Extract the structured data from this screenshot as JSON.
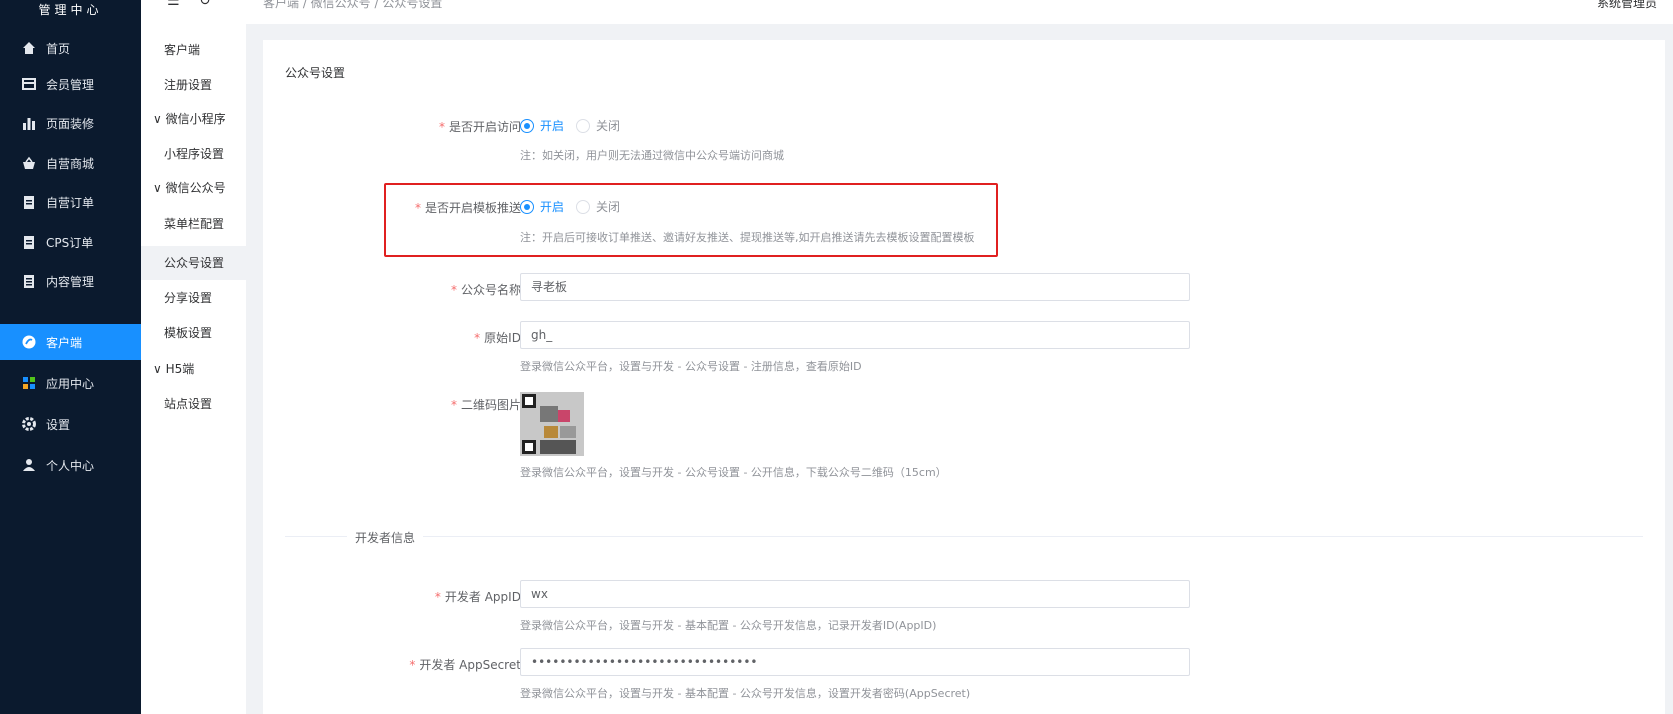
{
  "brand": "管理中心",
  "nav": [
    {
      "label": "首页",
      "icon": "home-icon"
    },
    {
      "label": "会员管理",
      "icon": "card-icon"
    },
    {
      "label": "页面装修",
      "icon": "bar-chart-icon"
    },
    {
      "label": "自营商城",
      "icon": "basket-icon"
    },
    {
      "label": "自营订单",
      "icon": "clipboard-icon"
    },
    {
      "label": "CPS订单",
      "icon": "clipboard-icon"
    },
    {
      "label": "内容管理",
      "icon": "document-icon"
    },
    {
      "label": "客户端",
      "icon": "client-icon"
    },
    {
      "label": "应用中心",
      "icon": "grid-icon"
    },
    {
      "label": "设置",
      "icon": "gear-icon"
    },
    {
      "label": "个人中心",
      "icon": "user-icon"
    }
  ],
  "subnav": [
    {
      "label": "客户端"
    },
    {
      "label": "注册设置"
    },
    {
      "label": "∨ 微信小程序"
    },
    {
      "label": "小程序设置"
    },
    {
      "label": "∨ 微信公众号"
    },
    {
      "label": "菜单栏配置"
    },
    {
      "label": "公众号设置"
    },
    {
      "label": "分享设置"
    },
    {
      "label": "模板设置"
    },
    {
      "label": "∨ H5端"
    },
    {
      "label": "站点设置"
    }
  ],
  "topbar": {
    "breadcrumb": "客户端 / 微信公众号 / 公众号设置",
    "admin": "系统管理员"
  },
  "card": {
    "title": "公众号设置"
  },
  "form": {
    "access": {
      "label": "是否开启访问:",
      "on": "开启",
      "off": "关闭",
      "hint": "注：如关闭，用户则无法通过微信中公众号端访问商城"
    },
    "template": {
      "label": "是否开启模板推送:",
      "on": "开启",
      "off": "关闭",
      "hint": "注：开启后可接收订单推送、邀请好友推送、提现推送等,如开启推送请先去模板设置配置模板"
    },
    "name": {
      "label": "公众号名称:",
      "value": "寻老板"
    },
    "origin": {
      "label": "原始ID:",
      "value": "gh_",
      "hint": "登录微信公众平台，设置与开发 - 公众号设置 - 注册信息，查看原始ID"
    },
    "qrcode": {
      "label": "二维码图片:",
      "hint": "登录微信公众平台，设置与开发 - 公众号设置 - 公开信息，下载公众号二维码（15cm）"
    },
    "dev_section": "开发者信息",
    "appid": {
      "label": "开发者 AppID:",
      "value": "wx",
      "hint": "登录微信公众平台，设置与开发 - 基本配置 - 公众号开发信息，记录开发者ID(AppID)"
    },
    "secret": {
      "label": "开发者 AppSecret:",
      "value": "••••••••••••••••••••••••••••••••",
      "hint": "登录微信公众平台，设置与开发 - 基本配置 - 公众号开发信息，设置开发者密码(AppSecret)"
    }
  }
}
